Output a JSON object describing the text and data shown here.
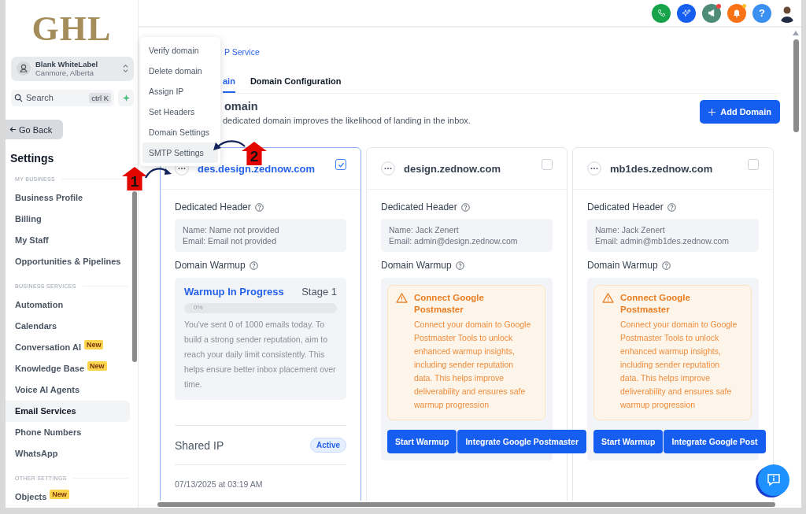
{
  "sidebar": {
    "logo": "GHL",
    "account": {
      "name": "Blank WhiteLabel",
      "location": "Canmore, Alberta"
    },
    "search": {
      "placeholder": "Search",
      "shortcut": "ctrl K"
    },
    "back_button": "Go Back",
    "title": "Settings",
    "sections": [
      {
        "heading": "MY BUSINESS",
        "items": [
          {
            "label": "Business Profile",
            "selected": false
          },
          {
            "label": "Billing",
            "selected": false
          },
          {
            "label": "My Staff",
            "selected": false
          },
          {
            "label": "Opportunities & Pipelines",
            "selected": false
          }
        ]
      },
      {
        "heading": "BUSINESS SERVICES",
        "items": [
          {
            "label": "Automation",
            "selected": false
          },
          {
            "label": "Calendars",
            "selected": false
          },
          {
            "label": "Conversation AI",
            "badge": "New",
            "selected": false
          },
          {
            "label": "Knowledge Base",
            "badge": "New",
            "selected": false
          },
          {
            "label": "Voice AI Agents",
            "selected": false
          },
          {
            "label": "Email Services",
            "selected": true
          },
          {
            "label": "Phone Numbers",
            "selected": false
          },
          {
            "label": "WhatsApp",
            "selected": false
          }
        ]
      },
      {
        "heading": "OTHER SETTINGS",
        "items": [
          {
            "label": "Objects",
            "badge": "New",
            "selected": false
          }
        ]
      }
    ]
  },
  "top_bar": {
    "help": "?"
  },
  "breadcrumb": "P Service",
  "tabs": [
    {
      "label": "ain",
      "selected": true
    },
    {
      "label": "Domain Configuration",
      "selected": false
    }
  ],
  "heading": "omain",
  "description": "dedicated domain improves the likelihood of landing in the inbox.",
  "add_button": "Add Domain",
  "context_menu": [
    {
      "label": "Verify domain",
      "selected": false
    },
    {
      "label": "Delete domain",
      "selected": false
    },
    {
      "label": "Assign IP",
      "selected": false
    },
    {
      "label": "Set Headers",
      "selected": false
    },
    {
      "label": "Domain Settings",
      "selected": false
    },
    {
      "label": "SMTP Settings",
      "selected": true
    }
  ],
  "annotations": [
    {
      "label": "1"
    },
    {
      "label": "2"
    }
  ],
  "domains": [
    {
      "name": "des.design.zednow.com",
      "selected": true,
      "header_title": "Dedicated Header",
      "header_name": "Name: Name not provided",
      "header_email": "Email: Email not provided",
      "warmup_title": "Domain Warmup",
      "warmup": {
        "kind": "progress",
        "title": "Warmup In Progress",
        "stage": "Stage 1",
        "level": 0,
        "percent": "0%",
        "text": "You've sent 0 of 1000 emails today. To build a strong sender reputation, aim to reach your daily limit consistently. This helps ensure better inbox placement over time."
      },
      "shared_ip": "Shared IP",
      "status": "Active",
      "date": "07/13/2025 at 03:19 AM"
    },
    {
      "name": "design.zednow.com",
      "selected": false,
      "header_title": "Dedicated Header",
      "header_name": "Name: Jack Zenert",
      "header_email": "Email: admin@design.zednow.com",
      "warmup_title": "Domain Warmup",
      "warmup": {
        "kind": "connect",
        "title": "Connect Google Postmaster",
        "text": "Connect your domain to Google Postmaster Tools to unlock enhanced warmup insights, including sender reputation data. This helps improve deliverability and ensures safe warmup progression",
        "buttons": [
          "Start Warmup",
          "Integrate Google Postmaster"
        ]
      }
    },
    {
      "name": "mb1des.zednow.com",
      "selected": false,
      "header_title": "Dedicated Header",
      "header_name": "Name: Jack Zenert",
      "header_email": "Email: admin@mb1des.zednow.com",
      "warmup_title": "Domain Warmup",
      "warmup": {
        "kind": "connect",
        "title": "Connect Google Postmaster",
        "text": "Connect your domain to Google Postmaster Tools to unlock enhanced warmup insights, including sender reputation data. This helps improve deliverability and ensures safe warmup progression",
        "buttons": [
          "Start Warmup",
          "Integrate Google Post"
        ]
      }
    }
  ]
}
